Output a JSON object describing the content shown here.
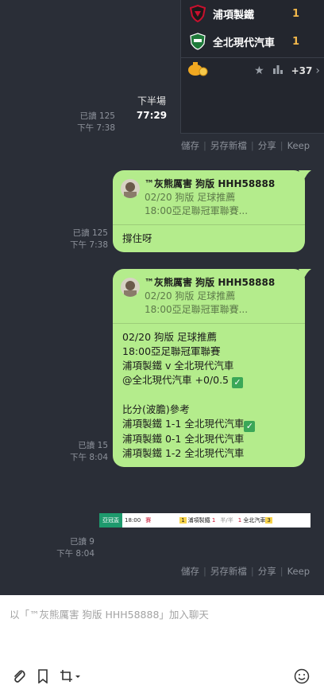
{
  "score_card": {
    "teams": [
      {
        "name": "浦項製鐵",
        "score": "1"
      },
      {
        "name": "全北現代汽車",
        "score": "1"
      }
    ],
    "more_count": "+37"
  },
  "match_status": {
    "period": "下半場",
    "time": "77:29"
  },
  "messages": [
    {
      "read": "已讀 125",
      "time": "下午 7:38"
    },
    {
      "read": "已讀 125",
      "time": "下午 7:38",
      "quote": {
        "name": "™灰熊厲害 狗版 HHH58888",
        "line1": "02/20 狗版 足球推薦",
        "line2": "18:00亞足聯冠軍聯賽..."
      },
      "body": "撐住呀"
    },
    {
      "read": "已讀 15",
      "time": "下午 8:04",
      "quote": {
        "name": "™灰熊厲害 狗版 HHH58888",
        "line1": "02/20 狗版 足球推薦",
        "line2": "18:00亞足聯冠軍聯賽..."
      },
      "body_lines": [
        "02/20 狗版 足球推薦",
        "18:00亞足聯冠軍聯賽",
        "浦項製鐵 v 全北現代汽車",
        "@全北現代汽車 +0/0.5",
        "",
        "比分(波膽)參考",
        "浦項製鐵 1-1 全北現代汽車",
        "浦項製鐵 0-1 全北現代汽車",
        "浦項製鐵 1-2 全北現代汽車"
      ]
    },
    {
      "read": "已讀 9",
      "time": "下午 8:04"
    }
  ],
  "strip": {
    "league": "亞冠盃",
    "time": "18:00",
    "live": "賽",
    "home_rank": "1",
    "home": "浦項製鐵",
    "home_score": "1",
    "half": "半/半",
    "away_score": "1",
    "away": "全北汽車",
    "away_rank": "3"
  },
  "actions": {
    "save": "儲存",
    "save_as": "另存新檔",
    "share": "分享",
    "keep": "Keep"
  },
  "input": {
    "placeholder": "以「™灰熊厲害 狗版 HHH58888」加入聊天"
  },
  "colors": {
    "background": "#2a2e37",
    "bubble": "#b4ec8c",
    "accent_score": "#f2b84b"
  }
}
